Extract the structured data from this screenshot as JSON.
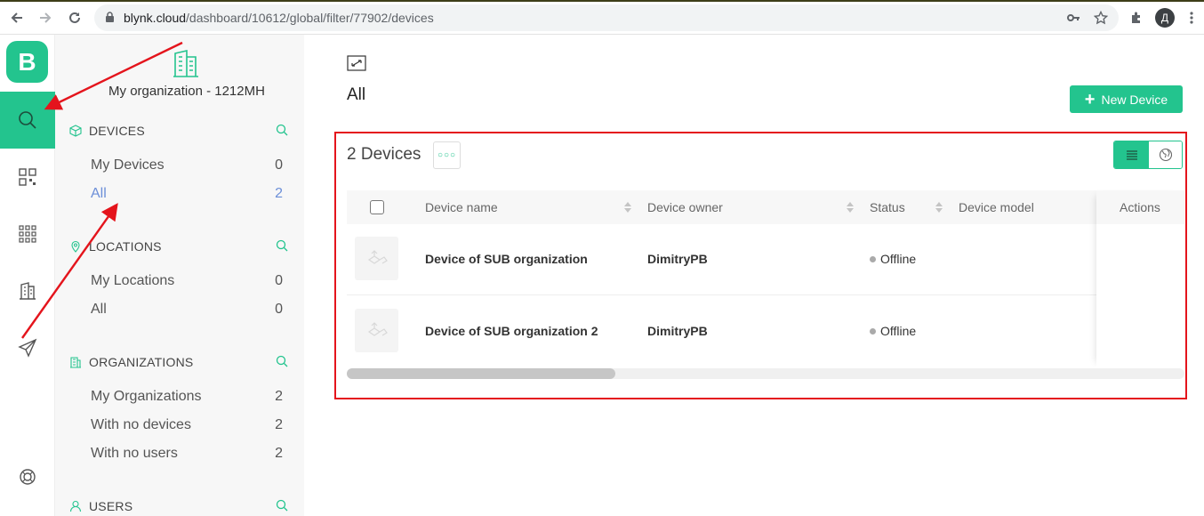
{
  "browser": {
    "url_host": "blynk.cloud",
    "url_path": "/dashboard/10612/global/filter/77902/devices",
    "profile_initial": "Д"
  },
  "rail": {
    "logo_letter": "B",
    "items": [
      "search-icon",
      "qr-icon",
      "grid-icon",
      "building-icon",
      "send-icon",
      "help-icon"
    ]
  },
  "sidebar": {
    "org_name": "My organization - 1212MH",
    "sections": [
      {
        "label": "DEVICES",
        "rows": [
          {
            "label": "My Devices",
            "count": "0"
          },
          {
            "label": "All",
            "count": "2"
          }
        ]
      },
      {
        "label": "LOCATIONS",
        "rows": [
          {
            "label": "My Locations",
            "count": "0"
          },
          {
            "label": "All",
            "count": "0"
          }
        ]
      },
      {
        "label": "ORGANIZATIONS",
        "rows": [
          {
            "label": "My Organizations",
            "count": "2"
          },
          {
            "label": "With no devices",
            "count": "2"
          },
          {
            "label": "With no users",
            "count": "2"
          }
        ]
      },
      {
        "label": "USERS"
      }
    ]
  },
  "main": {
    "title": "All",
    "new_device_label": "New Device",
    "device_count": "2 Devices",
    "columns": [
      "Device name",
      "Device owner",
      "Status",
      "Device model",
      "Actions"
    ],
    "rows": [
      {
        "name": "Device of SUB organization",
        "owner": "DimitryPB",
        "status": "Offline"
      },
      {
        "name": "Device of SUB organization 2",
        "owner": "DimitryPB",
        "status": "Offline"
      }
    ]
  },
  "colors": {
    "accent": "#23c48e",
    "annotation": "#e4141c",
    "active_link": "#6c8fd8"
  }
}
